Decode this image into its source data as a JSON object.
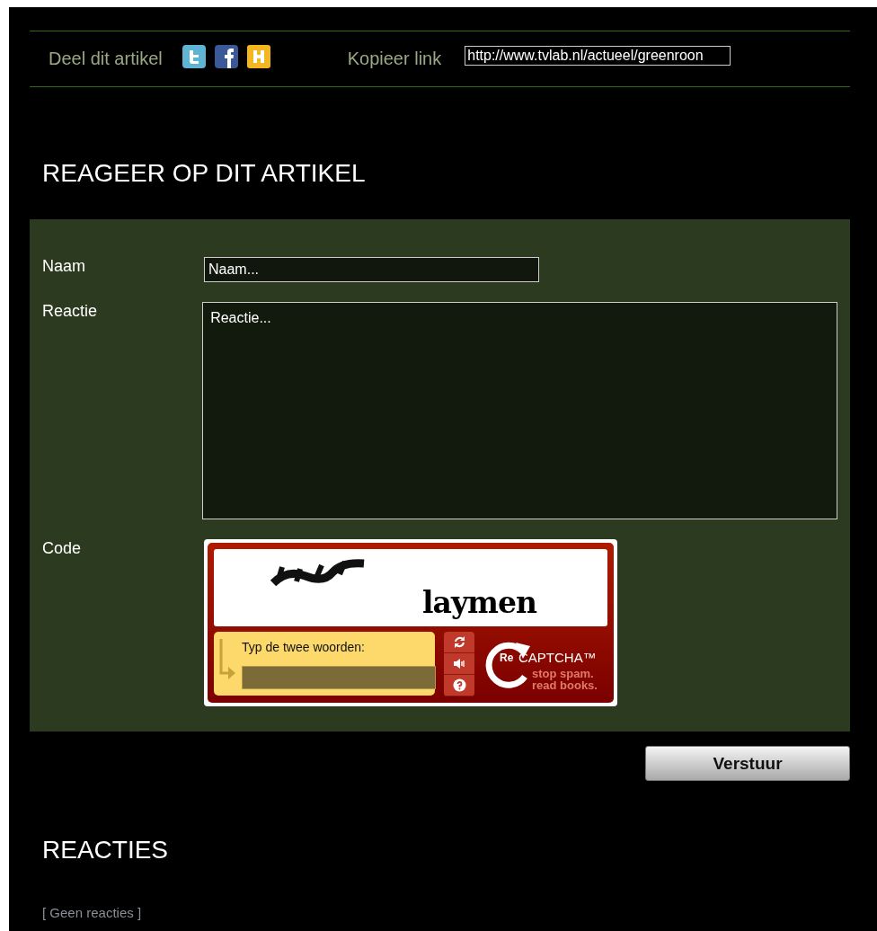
{
  "share": {
    "label": "Deel dit artikel",
    "copy_label": "Kopieer link",
    "link": "http://www.tvlab.nl/actueel/greenroon"
  },
  "form": {
    "title": "REAGEER OP DIT ARTIKEL",
    "fields": [
      {
        "kind": "input",
        "label": "Naam",
        "placeholder": "Naam..."
      },
      {
        "kind": "textarea",
        "label": "Reactie",
        "placeholder": "Reactie..."
      },
      {
        "kind": "captcha",
        "label": "Code"
      }
    ]
  },
  "captcha": {
    "word": "laymen",
    "prompt": "Typ de twee woorden:",
    "brand_prefix": "Re",
    "brand": "CAPTCHA™",
    "slogan": [
      "stop spam.",
      "read books."
    ]
  },
  "submit": "Verstuur",
  "comments": {
    "title": "REACTIES",
    "empty": "[ Geen reacties ]"
  }
}
